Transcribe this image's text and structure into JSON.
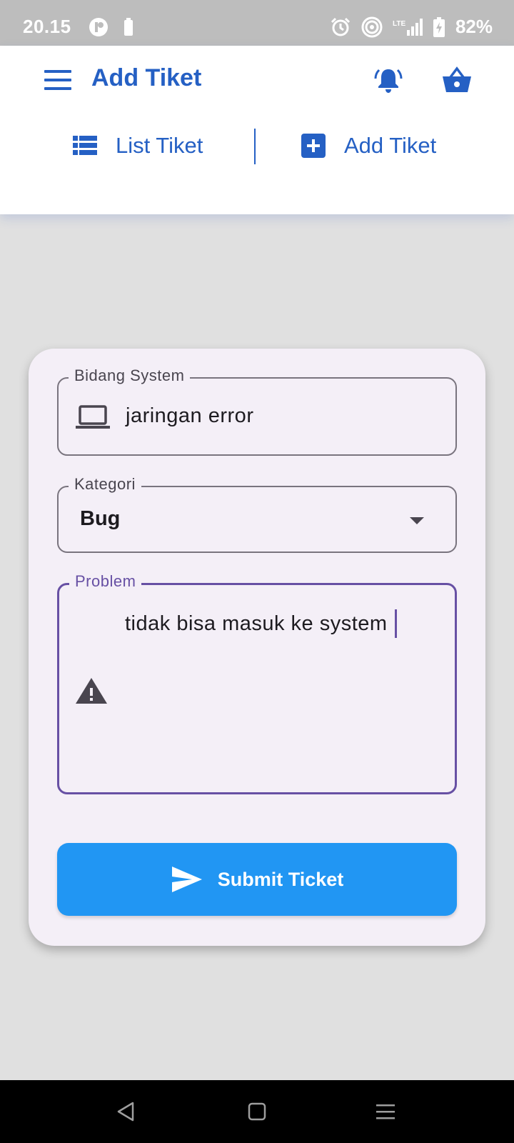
{
  "status_bar": {
    "time": "20.15",
    "battery_percent": "82%",
    "network": "LTE"
  },
  "header": {
    "title": "Add Tiket",
    "menu_icon": "hamburger-menu-icon",
    "notification_icon": "bell-ringing-icon",
    "cart_icon": "basket-icon"
  },
  "tabs": [
    {
      "label": "List Tiket",
      "icon": "list-icon"
    },
    {
      "label": "Add Tiket",
      "icon": "plus-square-icon"
    }
  ],
  "form": {
    "bidang_system": {
      "label": "Bidang System",
      "value": "jaringan error",
      "icon": "laptop-icon"
    },
    "kategori": {
      "label": "Kategori",
      "value": "Bug",
      "icon": "dropdown-arrow-icon"
    },
    "problem": {
      "label": "Problem",
      "value": "tidak bisa masuk ke system",
      "icon": "warning-icon"
    },
    "submit_label": "Submit Ticket",
    "submit_icon": "send-icon"
  },
  "colors": {
    "primary": "#2560c4",
    "submit": "#2196f3",
    "focus": "#6750a4",
    "card_bg": "#f4eff7",
    "page_bg": "#e0e0e0"
  }
}
